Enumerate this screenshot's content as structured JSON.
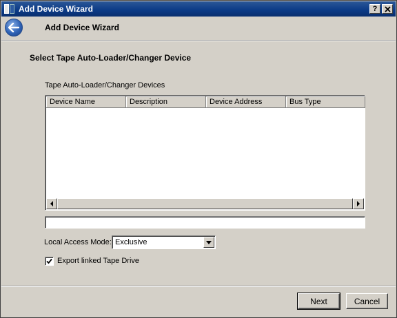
{
  "window": {
    "title": "Add Device Wizard",
    "help_glyph": "?",
    "close_glyph": "X"
  },
  "header": {
    "title": "Add Device Wizard"
  },
  "main": {
    "section_title": "Select Tape Auto-Loader/Changer Device",
    "group_label": "Tape Auto-Loader/Changer Devices",
    "columns": [
      "Device Name",
      "Description",
      "Device Address",
      "Bus Type"
    ],
    "rows": [],
    "text_field_value": "",
    "access_mode_label": "Local Access Mode:",
    "access_mode_value": "Exclusive",
    "export_checkbox_label": "Export linked Tape Drive",
    "export_checked": true
  },
  "footer": {
    "next_label": "Next",
    "cancel_label": "Cancel"
  },
  "icons": {
    "back": "back-arrow-icon",
    "app": "wizard-app-icon"
  },
  "colors": {
    "titlebar": "#0b3a86",
    "window_bg": "#d4d0c8",
    "back_button": "#2f63b6"
  }
}
